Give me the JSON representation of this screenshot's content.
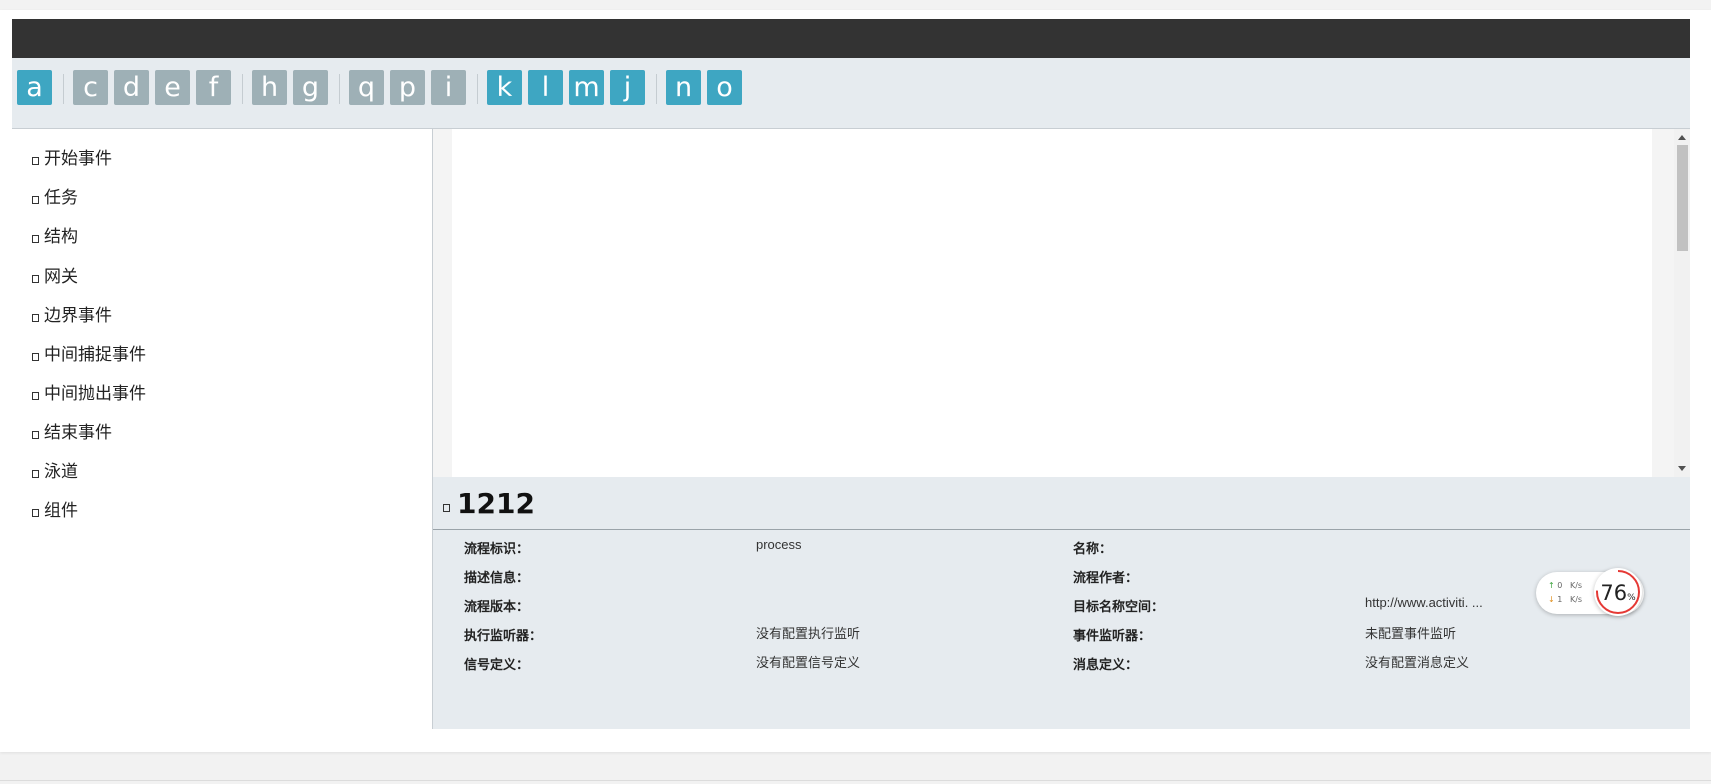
{
  "toolbar": {
    "buttons": [
      "a",
      "c",
      "d",
      "e",
      "f",
      "h",
      "g",
      "q",
      "p",
      "i",
      "k",
      "l",
      "m",
      "j",
      "n",
      "o"
    ]
  },
  "sidebar": {
    "items": [
      "开始事件",
      "任务",
      "结构",
      "网关",
      "边界事件",
      "中间捕捉事件",
      "中间抛出事件",
      "结束事件",
      "泳道",
      "组件"
    ]
  },
  "props": {
    "title": "1212",
    "rows": [
      {
        "label1": "流程标识：",
        "value1": "process",
        "label2": "名称：",
        "value2": ""
      },
      {
        "label1": "描述信息：",
        "value1": "",
        "label2": "流程作者：",
        "value2": ""
      },
      {
        "label1": "流程版本：",
        "value1": "",
        "label2": "目标名称空间：",
        "value2": "http://www.activiti. ..."
      },
      {
        "label1": "执行监听器：",
        "value1": "没有配置执行监听",
        "label2": "事件监听器：",
        "value2": "未配置事件监听"
      },
      {
        "label1": "信号定义：",
        "value1": "没有配置信号定义",
        "label2": "消息定义：",
        "value2": "没有配置消息定义"
      }
    ]
  },
  "net_widget": {
    "up_value": "0",
    "up_unit": "K/s",
    "down_value": "1",
    "down_unit": "K/s",
    "percent": "76",
    "percent_sign": "%",
    "percent_value": 76,
    "ring_color": "#e53935"
  }
}
